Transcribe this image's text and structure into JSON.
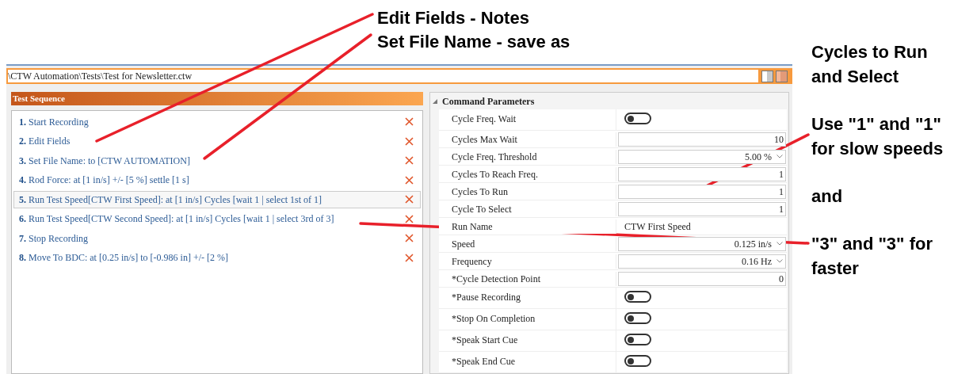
{
  "annotations": {
    "top": [
      "Edit Fields - Notes",
      "Set File Name - save as"
    ],
    "side": [
      "Cycles to Run",
      "and Select",
      "Use \"1\" and \"1\"",
      "for slow speeds",
      "and",
      "\"3\" and \"3\" for",
      "faster"
    ]
  },
  "path_bar": {
    "path": "\\CTW Automation\\Tests\\Test for Newsletter.ctw"
  },
  "test_sequence": {
    "title": "Test Sequence",
    "steps": [
      {
        "number": "1.",
        "text": "Start Recording",
        "selected": false
      },
      {
        "number": "2.",
        "text": "Edit Fields",
        "selected": false
      },
      {
        "number": "3.",
        "text": "Set File Name: to [CTW AUTOMATION]",
        "selected": false
      },
      {
        "number": "4.",
        "text": "Rod Force: at [1 in/s] +/- [5 %] settle [1 s]",
        "selected": false
      },
      {
        "number": "5.",
        "text": "Run Test Speed[CTW First Speed]: at [1 in/s] Cycles [wait 1  |  select 1st of 1]",
        "selected": true
      },
      {
        "number": "6.",
        "text": "Run Test Speed[CTW Second Speed]: at [1 in/s] Cycles [wait 1  |  select 3rd of 3]",
        "selected": false
      },
      {
        "number": "7.",
        "text": "Stop Recording",
        "selected": false
      },
      {
        "number": "8.",
        "text": "Move To BDC: at [0.25 in/s] to [-0.986 in] +/- [2 %]",
        "selected": false
      }
    ]
  },
  "command_parameters": {
    "title": "Command Parameters",
    "rows": [
      {
        "kind": "toggle",
        "label": "Cycle Freq. Wait",
        "on": false
      },
      {
        "kind": "number",
        "label": "Cycles Max Wait",
        "value": "10"
      },
      {
        "kind": "dropdown",
        "label": "Cycle Freq. Threshold",
        "value": "5.00 %"
      },
      {
        "kind": "number",
        "label": "Cycles To Reach Freq.",
        "value": "1"
      },
      {
        "kind": "number",
        "label": "Cycles To Run",
        "value": "1"
      },
      {
        "kind": "number",
        "label": "Cycle To Select",
        "value": "1"
      },
      {
        "kind": "text",
        "label": "Run Name",
        "value": "CTW First Speed"
      },
      {
        "kind": "dropdown",
        "label": "Speed",
        "value": "0.125 in/s"
      },
      {
        "kind": "dropdown",
        "label": "Frequency",
        "value": "0.16 Hz"
      },
      {
        "kind": "number",
        "label": "*Cycle Detection Point",
        "value": "0"
      },
      {
        "kind": "toggle",
        "label": "*Pause Recording",
        "on": false
      },
      {
        "kind": "toggle",
        "label": "*Stop On Completion",
        "on": false
      },
      {
        "kind": "toggle",
        "label": "*Speak Start Cue",
        "on": false
      },
      {
        "kind": "toggle",
        "label": "*Speak End Cue",
        "on": false
      }
    ]
  }
}
